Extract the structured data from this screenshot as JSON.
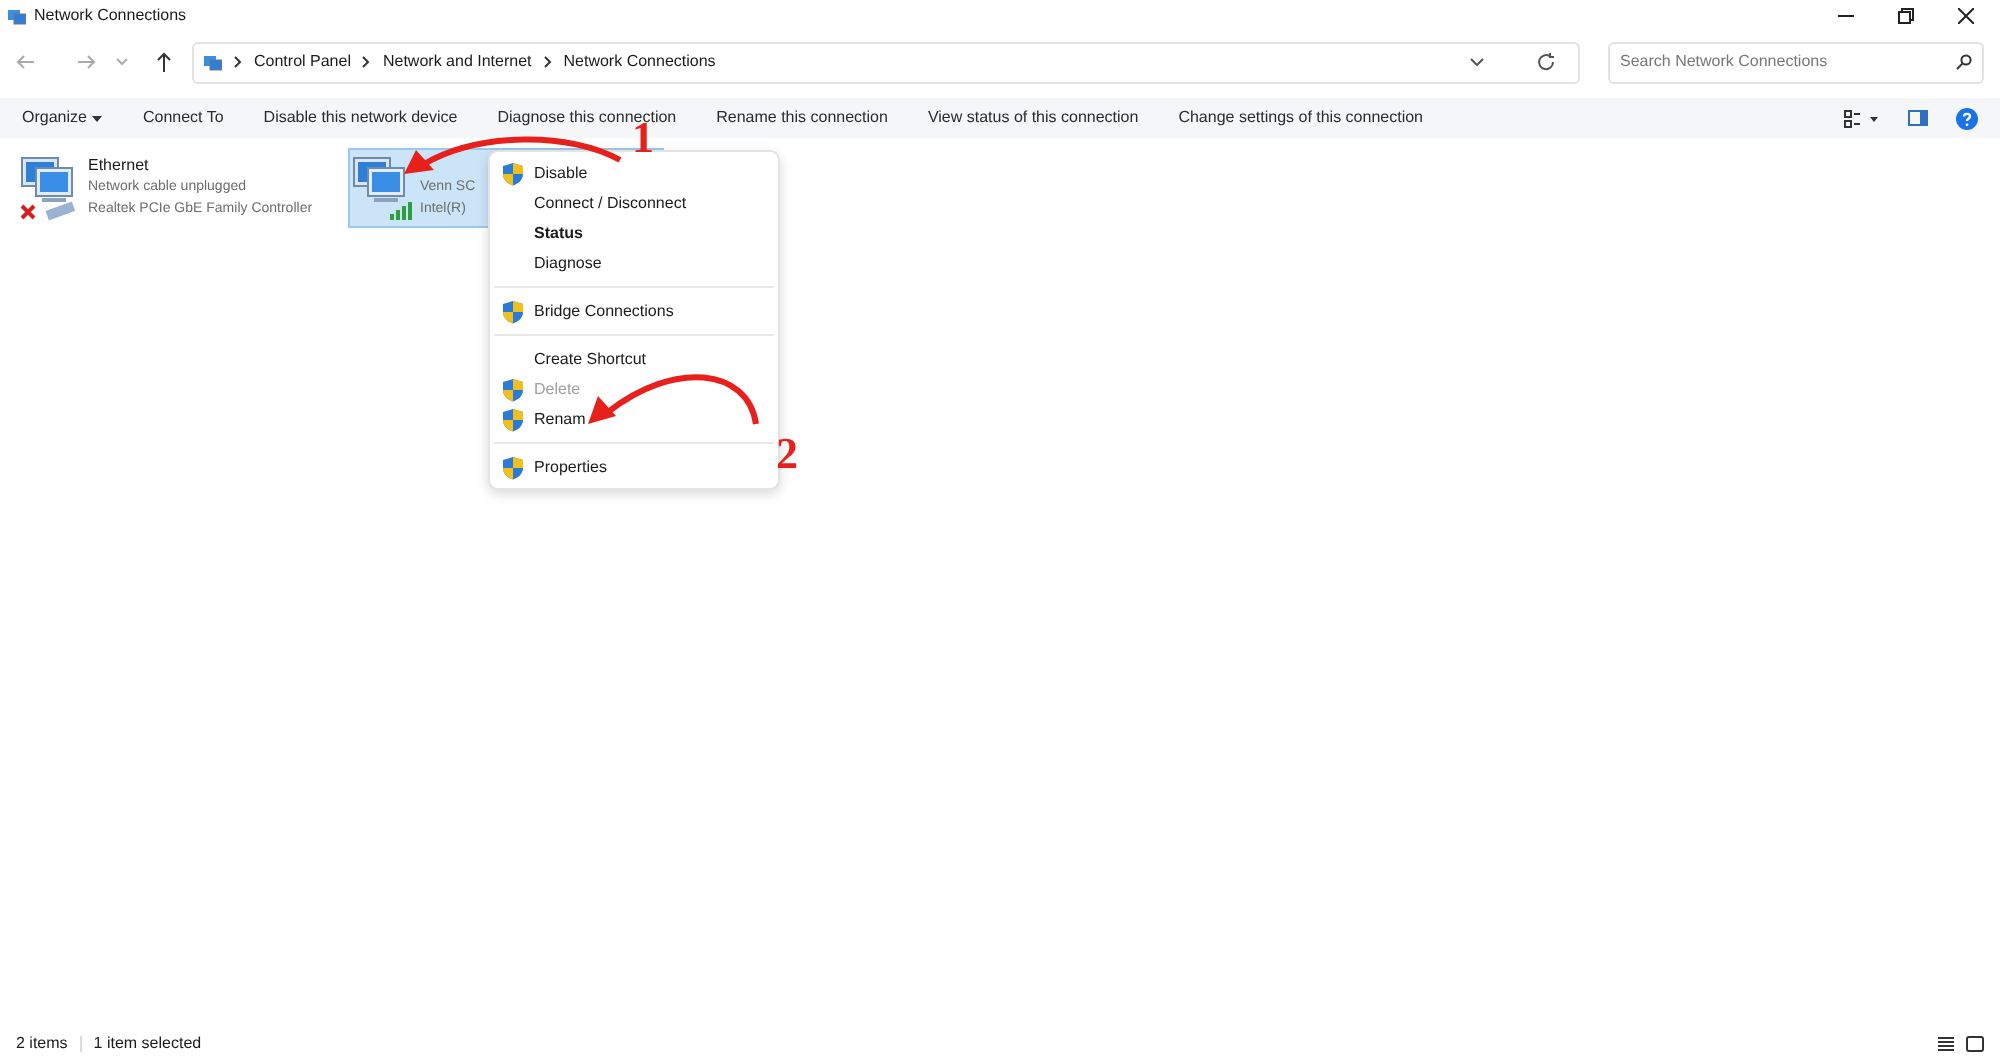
{
  "window": {
    "title": "Network Connections"
  },
  "address_bar": {
    "path": [
      "Control Panel",
      "Network and Internet",
      "Network Connections"
    ]
  },
  "search": {
    "placeholder": "Search Network Connections"
  },
  "toolbar": [
    "Organize",
    "Connect To",
    "Disable this network device",
    "Diagnose this connection",
    "Rename this connection",
    "View status of this connection",
    "Change settings of this connection"
  ],
  "connections": [
    {
      "kind": "ethernet",
      "selected": false,
      "name": "Ethernet",
      "status": "Network cable unplugged",
      "device": "Realtek PCIe GbE Family Controller"
    },
    {
      "kind": "wifi",
      "selected": true,
      "status": "Venn SC",
      "device": "Intel(R)"
    }
  ],
  "context_menu": [
    {
      "kind": "item",
      "label": "Disable",
      "shield": true,
      "default": false,
      "disabled": false
    },
    {
      "kind": "item",
      "label": "Connect / Disconnect",
      "shield": false,
      "default": false,
      "disabled": false
    },
    {
      "kind": "item",
      "label": "Status",
      "shield": false,
      "default": true,
      "disabled": false
    },
    {
      "kind": "item",
      "label": "Diagnose",
      "shield": false,
      "default": false,
      "disabled": false
    },
    {
      "kind": "separator"
    },
    {
      "kind": "item",
      "label": "Bridge Connections",
      "shield": true,
      "default": false,
      "disabled": false
    },
    {
      "kind": "separator"
    },
    {
      "kind": "item",
      "label": "Create Shortcut",
      "shield": false,
      "default": false,
      "disabled": false
    },
    {
      "kind": "item",
      "label": "Delete",
      "shield": true,
      "default": false,
      "disabled": true
    },
    {
      "kind": "item",
      "label": "Renam",
      "shield": true,
      "default": false,
      "disabled": false
    },
    {
      "kind": "separator"
    },
    {
      "kind": "item",
      "label": "Properties",
      "shield": true,
      "default": false,
      "disabled": false
    }
  ],
  "annotations": [
    "1",
    "2"
  ],
  "status_bar": {
    "count": "2 items",
    "selection": "1 item selected"
  }
}
